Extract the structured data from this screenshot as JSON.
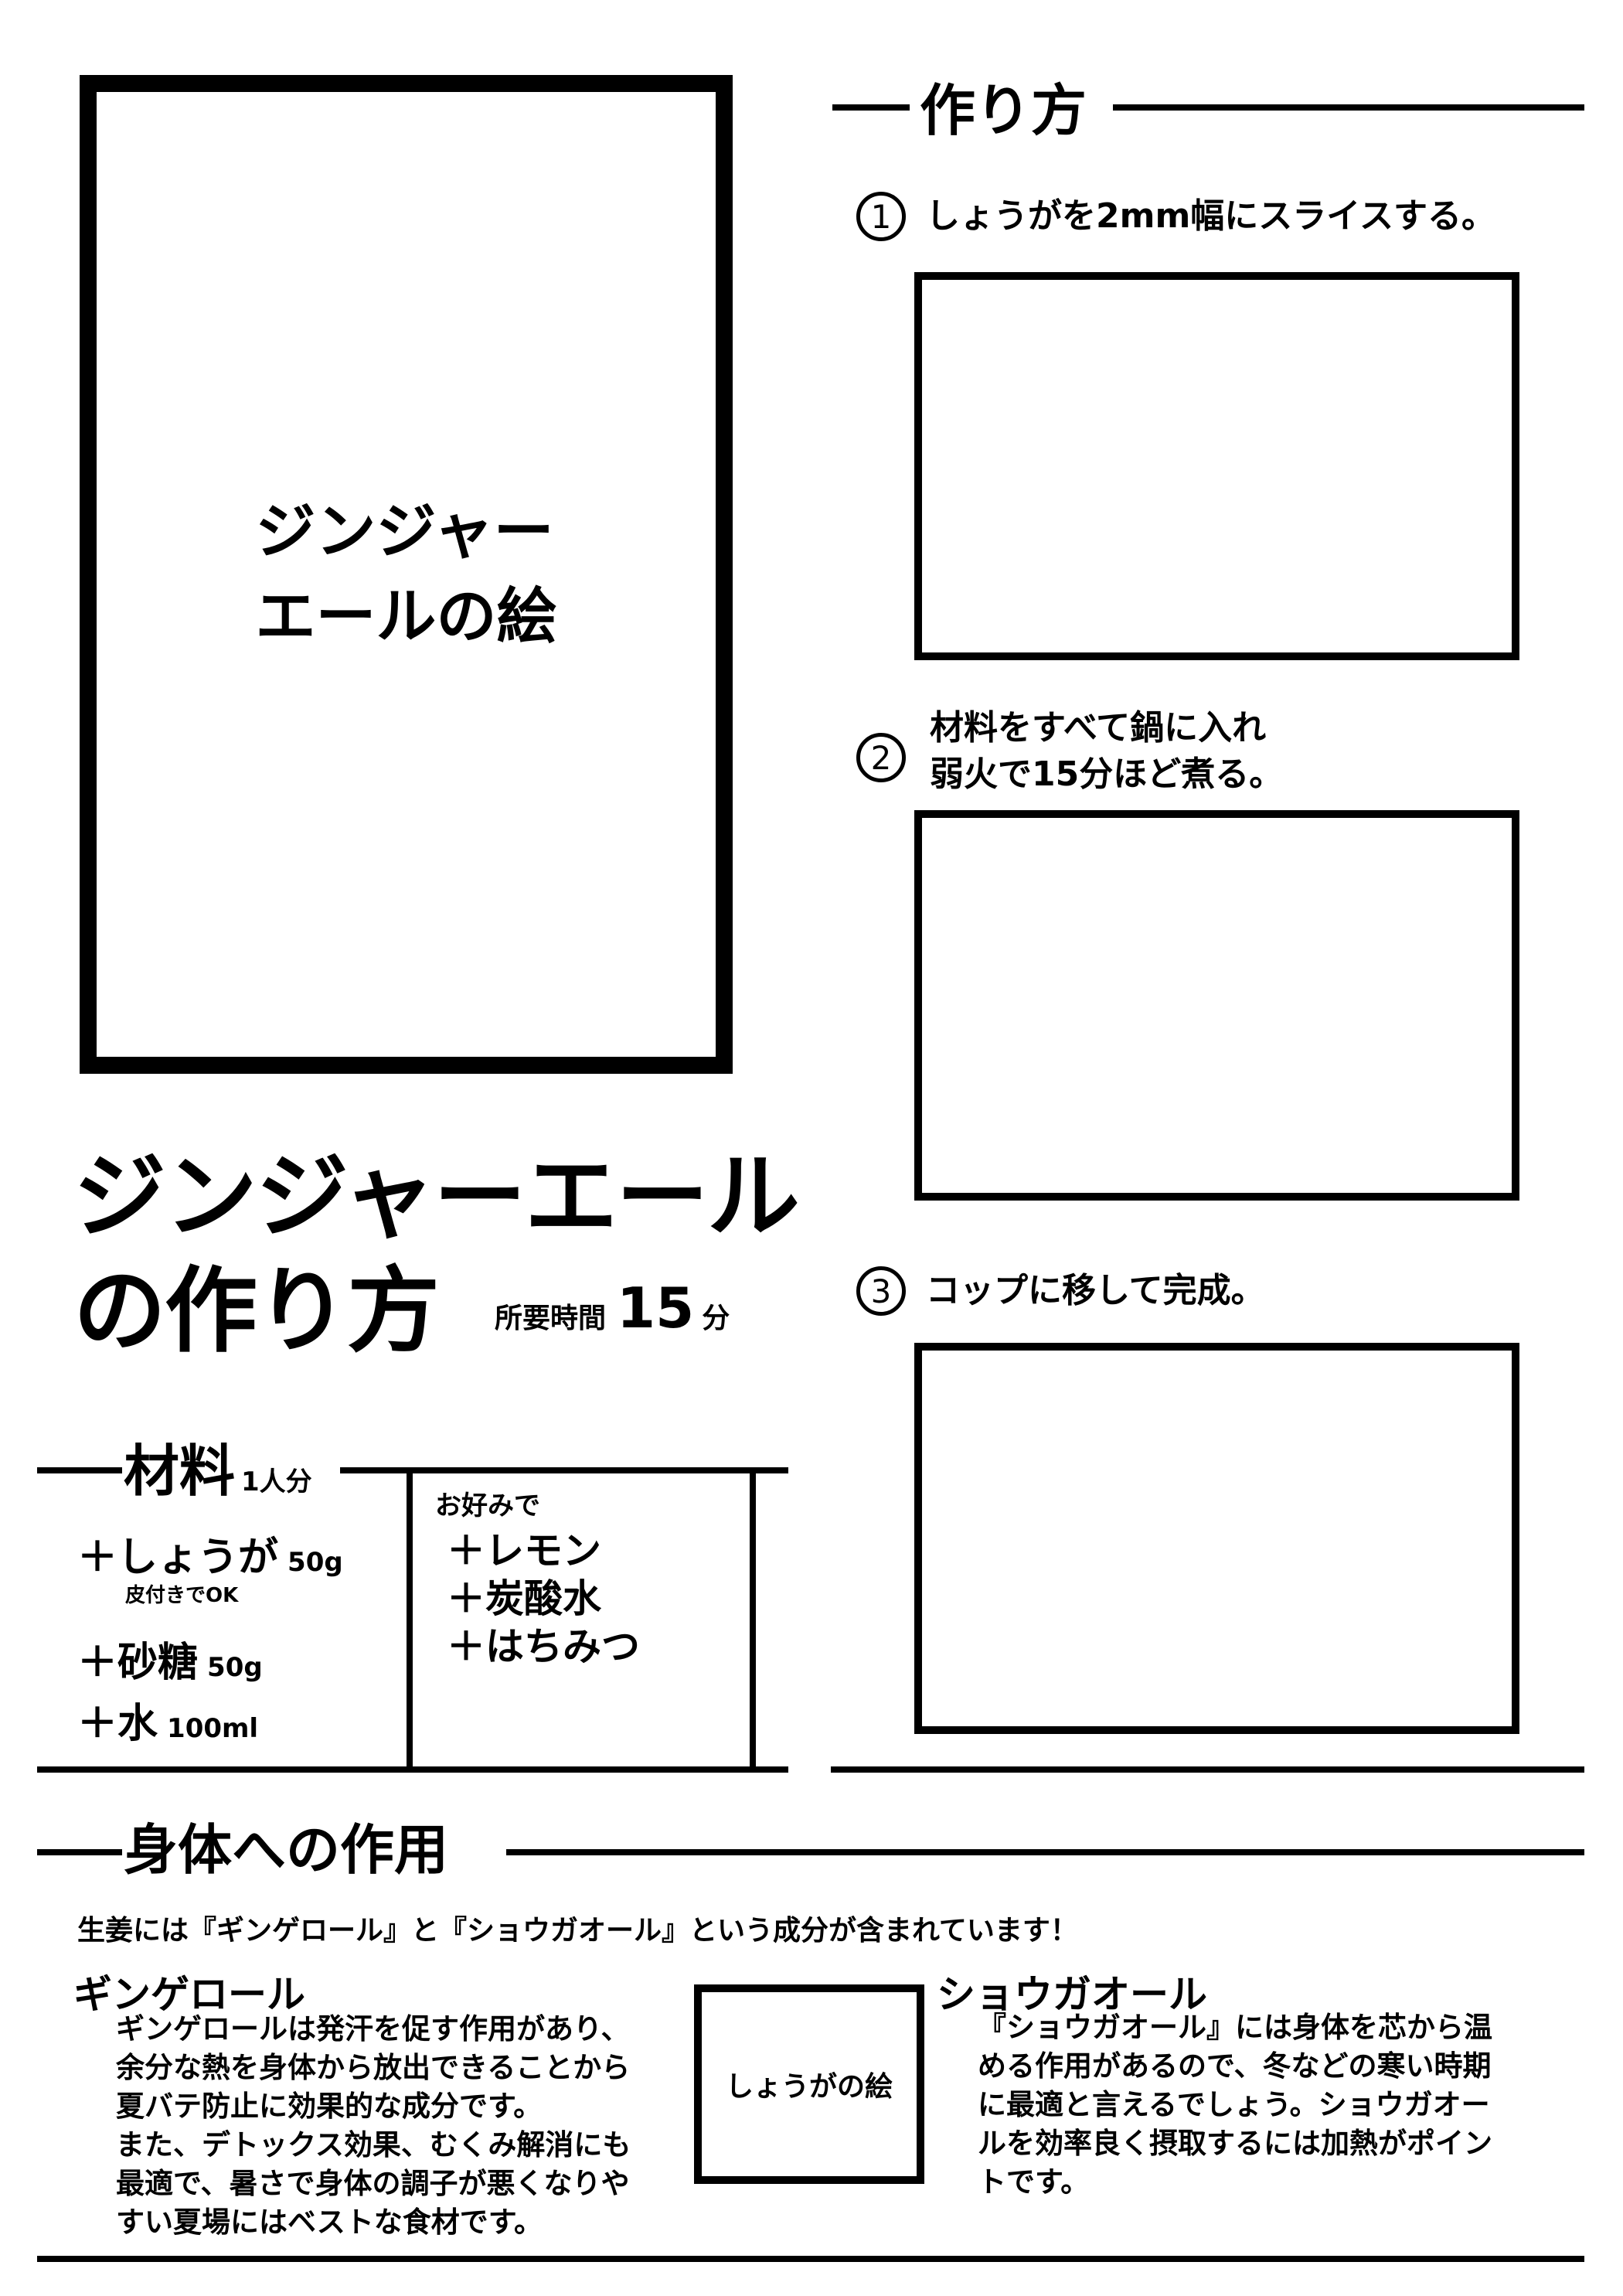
{
  "cover": {
    "illustration_label": "ジンジャー\nエールの絵",
    "title_line1": "ジンジャーエール",
    "title_line2": "の作り方",
    "time_label": "所要時間",
    "time_value": "15",
    "time_unit": "分"
  },
  "method": {
    "heading": "作り方",
    "steps": [
      {
        "number": "1",
        "text": "しょうがを2mm幅にスライスする。"
      },
      {
        "number": "2",
        "text": "材料をすべて鍋に入れ\n弱火で15分ほど煮る。"
      },
      {
        "number": "3",
        "text": "コップに移して完成。"
      }
    ]
  },
  "ingredients": {
    "heading": "材料",
    "serving": "1人分",
    "items": [
      {
        "name": "しょうが",
        "amount": "50g",
        "note": "皮付きでOK"
      },
      {
        "name": "砂糖",
        "amount": "50g"
      },
      {
        "name": "水",
        "amount": "100ml"
      }
    ],
    "optional_heading": "お好みで",
    "optional_items": [
      "レモン",
      "炭酸水",
      "はちみつ"
    ],
    "bullet": "＋"
  },
  "effects": {
    "heading": "身体への作用",
    "intro": "生姜には『ギンゲロール』と『ショウガオール』という成分が含まれています！",
    "gingerol": {
      "title": "ギンゲロール",
      "text": "ギンゲロールは発汗を促す作用があり、\n余分な熱を身体から放出できることから\n夏バテ防止に効果的な成分です。\nまた、デトックス効果、むくみ解消にも\n最適で、暑さで身体の調子が悪くなりや\nすい夏場にはベストな食材です。"
    },
    "ginger_picture_label": "しょうがの絵",
    "shogaol": {
      "title": "ショウガオール",
      "text": "『ショウガオール』には身体を芯から温\nめる作用があるので、冬などの寒い時期\nに最適と言えるでしょう。ショウガオー\nルを効率良く摂取するには加熱がポイン\nトです。"
    }
  }
}
